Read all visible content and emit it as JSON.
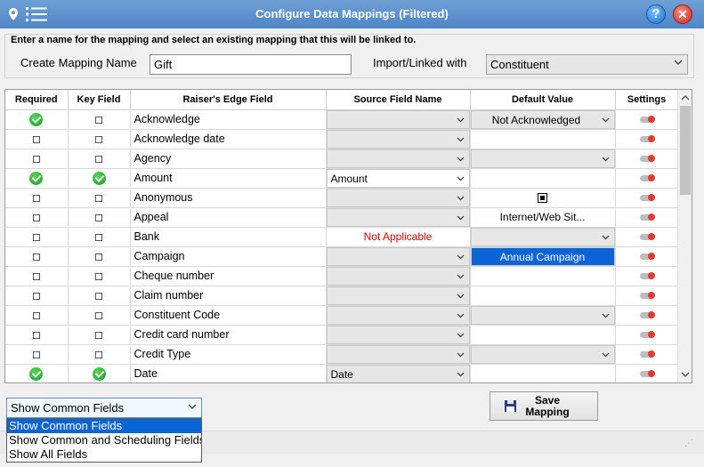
{
  "window": {
    "title": "Configure  Data Mappings (Filtered)",
    "help_label": "?",
    "close_label": "✕"
  },
  "header": {
    "instruction": "Enter a name for the mapping and select an existing mapping that this will be linked to.",
    "mapping_name_label": "Create Mapping Name",
    "mapping_name_value": "Gift",
    "linked_label": "Import/Linked with",
    "linked_value": "Constituent"
  },
  "grid": {
    "columns": [
      "Required",
      "Key Field",
      "Raiser's Edge Field",
      "Source Field Name",
      "Default Value",
      "Settings"
    ],
    "rows": [
      {
        "required": true,
        "key": false,
        "field": "Acknowledge",
        "source": "",
        "source_style": "dd",
        "default": "Not Acknowledged",
        "default_style": "dd"
      },
      {
        "required": false,
        "key": false,
        "field": "Acknowledge date",
        "source": "",
        "source_style": "dd",
        "default": "",
        "default_style": "blank"
      },
      {
        "required": false,
        "key": false,
        "field": "Agency",
        "source": "",
        "source_style": "dd",
        "default": "",
        "default_style": "dd"
      },
      {
        "required": true,
        "key": true,
        "field": "Amount",
        "source": "Amount",
        "source_style": "dd-white",
        "default": "",
        "default_style": "blank"
      },
      {
        "required": false,
        "key": false,
        "field": "Anonymous",
        "source": "",
        "source_style": "dd",
        "default": "",
        "default_style": "checkbox"
      },
      {
        "required": false,
        "key": false,
        "field": "Appeal",
        "source": "",
        "source_style": "dd",
        "default": "Internet/Web Sit...",
        "default_style": "text"
      },
      {
        "required": false,
        "key": false,
        "field": "Bank",
        "source": "Not Applicable",
        "source_style": "na",
        "default": "",
        "default_style": "dd"
      },
      {
        "required": false,
        "key": false,
        "field": "Campaign",
        "source": "",
        "source_style": "dd",
        "default": "Annual Campaign",
        "default_style": "selected"
      },
      {
        "required": false,
        "key": false,
        "field": "Cheque number",
        "source": "",
        "source_style": "dd",
        "default": "",
        "default_style": "blank"
      },
      {
        "required": false,
        "key": false,
        "field": "Claim number",
        "source": "",
        "source_style": "dd",
        "default": "",
        "default_style": "blank"
      },
      {
        "required": false,
        "key": false,
        "field": "Constituent Code",
        "source": "",
        "source_style": "dd",
        "default": "",
        "default_style": "dd"
      },
      {
        "required": false,
        "key": false,
        "field": "Credit card number",
        "source": "",
        "source_style": "dd",
        "default": "",
        "default_style": "blank"
      },
      {
        "required": false,
        "key": false,
        "field": "Credit Type",
        "source": "",
        "source_style": "dd",
        "default": "",
        "default_style": "dd"
      },
      {
        "required": true,
        "key": true,
        "field": "Date",
        "source": "Date",
        "source_style": "dd",
        "default": "",
        "default_style": "blank"
      }
    ]
  },
  "footer": {
    "show_select_value": "Show Common Fields",
    "show_options": [
      "Show Common Fields",
      "Show Common and Scheduling Fields",
      "Show All Fields"
    ],
    "selected_option": 0,
    "save_label_line1": "Save",
    "save_label_line2": "Mapping"
  },
  "colors": {
    "title_bar": "#5b8fcd",
    "selection_blue": "#0a64d6",
    "not_applicable_red": "#d40000",
    "check_green": "#28a82e"
  }
}
